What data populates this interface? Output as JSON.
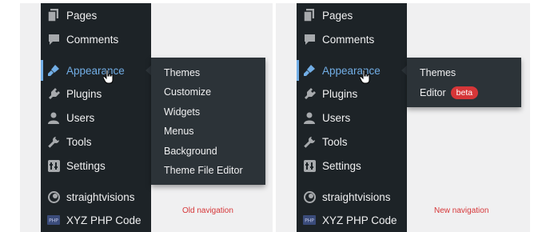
{
  "menu": {
    "items": [
      {
        "label": "Pages",
        "icon": "pages-icon"
      },
      {
        "label": "Comments",
        "icon": "comments-icon"
      },
      {
        "label": "Appearance",
        "icon": "appearance-icon"
      },
      {
        "label": "Plugins",
        "icon": "plugins-icon"
      },
      {
        "label": "Users",
        "icon": "users-icon"
      },
      {
        "label": "Tools",
        "icon": "tools-icon"
      },
      {
        "label": "Settings",
        "icon": "settings-icon"
      },
      {
        "label": "straightvisions",
        "icon": "straightvisions-icon"
      },
      {
        "label": "XYZ PHP Code",
        "icon": "php-icon"
      }
    ]
  },
  "old_submenu": [
    "Themes",
    "Customize",
    "Widgets",
    "Menus",
    "Background",
    "Theme File Editor"
  ],
  "new_submenu": {
    "themes": "Themes",
    "editor": "Editor",
    "editor_badge": "beta"
  },
  "captions": {
    "old": "Old navigation",
    "new": "New navigation"
  },
  "colors": {
    "sidebar_bg": "#1d2327",
    "flyout_bg": "#2c3338",
    "active": "#72aee6",
    "badge": "#d63638",
    "caption": "#d63638"
  }
}
